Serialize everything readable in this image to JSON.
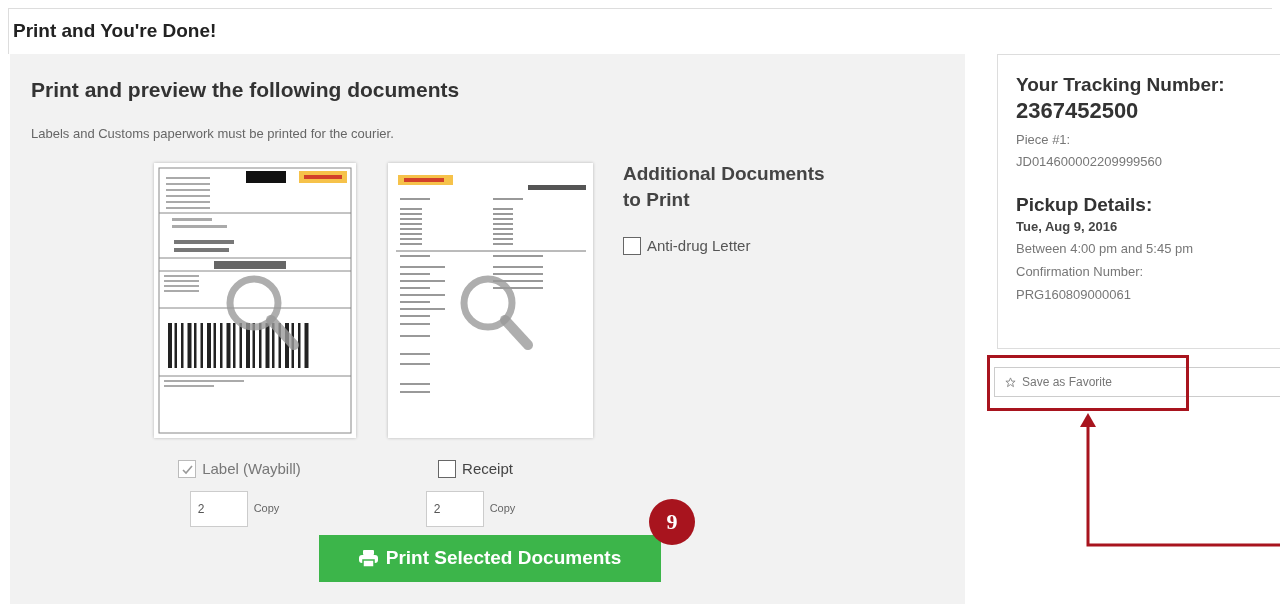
{
  "page": {
    "title": "Print and You're Done!"
  },
  "documents_panel": {
    "heading": "Print and preview the following documents",
    "note": "Labels and Customs paperwork must be printed for the courier.",
    "documents": [
      {
        "kind": "waybill",
        "label": "Label (Waybill)",
        "checked": true,
        "disabled": true,
        "copies": "2",
        "copy_label": "Copy"
      },
      {
        "kind": "receipt",
        "label": "Receipt",
        "checked": false,
        "disabled": false,
        "copies": "2",
        "copy_label": "Copy"
      }
    ],
    "additional": {
      "heading": "Additional Documents to Print",
      "items": [
        {
          "label": "Anti-drug Letter",
          "checked": false
        }
      ]
    },
    "print_button": "Print Selected Documents",
    "step_badge": "9"
  },
  "tracking": {
    "heading": "Your Tracking Number:",
    "number": "2367452500",
    "piece_label": "Piece #1:",
    "piece_number": "JD014600002209999560",
    "pickup_heading": "Pickup Details:",
    "pickup_date": "Tue, Aug 9, 2016",
    "pickup_window": "Between 4:00 pm and 5:45 pm",
    "confirmation_label": "Confirmation Number:",
    "confirmation_number": "PRG160809000061"
  },
  "save_favorite_button": {
    "label": "Save as Favorite"
  }
}
